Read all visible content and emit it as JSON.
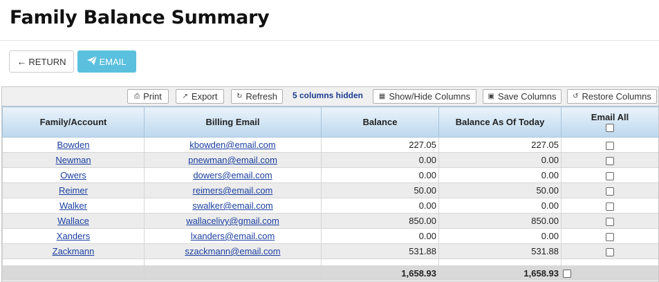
{
  "page": {
    "title": "Family Balance Summary"
  },
  "buttons": {
    "return_label": "RETURN",
    "email_label": "EMAIL"
  },
  "toolbar": {
    "print": "Print",
    "export": "Export",
    "refresh": "Refresh",
    "hidden_note": "5 columns hidden",
    "show_hide": "Show/Hide Columns",
    "save_columns": "Save Columns",
    "restore_columns": "Restore Columns"
  },
  "table": {
    "headers": [
      "Family/Account",
      "Billing Email",
      "Balance",
      "Balance As Of Today",
      "Email All"
    ],
    "rows": [
      {
        "family": "Bowden",
        "email": "kbowden@email.com",
        "balance": "227.05",
        "balance_today": "227.05"
      },
      {
        "family": "Newman",
        "email": "pnewman@email.com",
        "balance": "0.00",
        "balance_today": "0.00"
      },
      {
        "family": "Owers",
        "email": "dowers@email.com",
        "balance": "0.00",
        "balance_today": "0.00"
      },
      {
        "family": "Reimer",
        "email": "reimers@email.com",
        "balance": "50.00",
        "balance_today": "50.00"
      },
      {
        "family": "Walker",
        "email": "swalker@email.com",
        "balance": "0.00",
        "balance_today": "0.00"
      },
      {
        "family": "Wallace",
        "email": "wallacelivy@gmail.com",
        "balance": "850.00",
        "balance_today": "850.00"
      },
      {
        "family": "Xanders",
        "email": "lxanders@email.com",
        "balance": "0.00",
        "balance_today": "0.00"
      },
      {
        "family": "Zackmann",
        "email": "szackmann@email.com",
        "balance": "531.88",
        "balance_today": "531.88"
      }
    ],
    "totals": {
      "balance": "1,658.93",
      "balance_today": "1,658.93"
    }
  },
  "colors": {
    "email_button": "#5bc0de",
    "link": "#1b3fa0",
    "header_gradient_top": "#eaf3fb",
    "header_gradient_bottom": "#bcd8ee"
  }
}
